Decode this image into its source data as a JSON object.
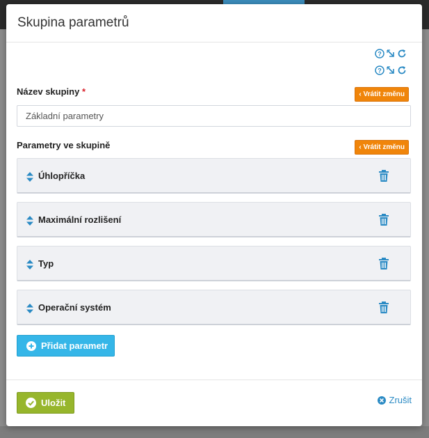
{
  "modal": {
    "title": "Skupina parametrů"
  },
  "group_name": {
    "label": "Název skupiny",
    "required_mark": "*",
    "value": "Základní parametry",
    "revert_label": "‹ Vrátit změnu"
  },
  "params_section": {
    "label": "Parametry ve skupině",
    "revert_label": "‹ Vrátit změnu",
    "items": [
      {
        "name": "Úhlopříčka"
      },
      {
        "name": "Maximální rozlišení"
      },
      {
        "name": "Typ"
      },
      {
        "name": "Operační systém"
      }
    ],
    "add_button_label": "Přidat parametr"
  },
  "footer": {
    "save_label": "Uložit",
    "cancel_label": "Zrušit"
  },
  "icons": {
    "help": "question-circle-icon",
    "expand": "expand-arrow-icon",
    "refresh": "refresh-icon",
    "drag": "sort-arrows-icon",
    "delete": "trash-icon",
    "add": "plus-circle-icon",
    "save": "check-circle-icon",
    "cancel": "times-circle-icon"
  },
  "colors": {
    "accent_blue": "#35b6e8",
    "link_blue": "#2a8ac4",
    "revert_orange": "#f0850a",
    "save_green": "#97b62c"
  }
}
